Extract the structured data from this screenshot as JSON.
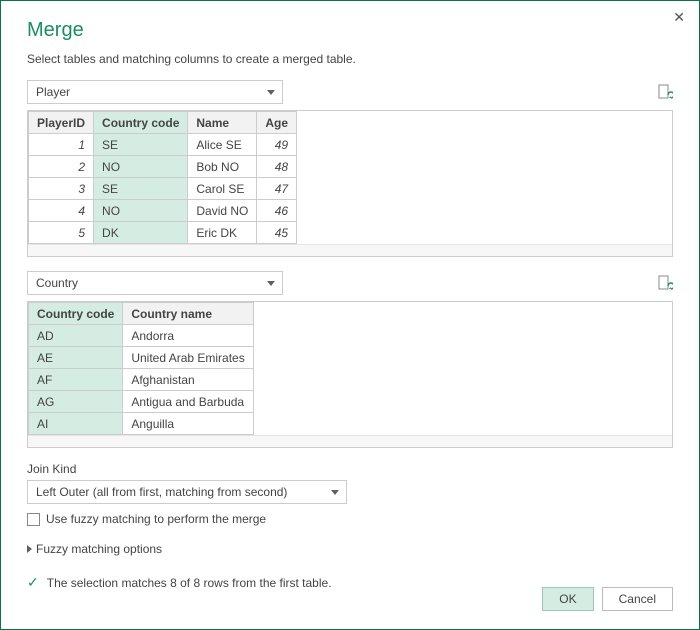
{
  "title": "Merge",
  "subtitle": "Select tables and matching columns to create a merged table.",
  "table1_select": "Player",
  "table1": {
    "headers": [
      "PlayerID",
      "Country code",
      "Name",
      "Age"
    ],
    "selectedCol": 1,
    "rows": [
      [
        "1",
        "SE",
        "Alice SE",
        "49"
      ],
      [
        "2",
        "NO",
        "Bob NO",
        "48"
      ],
      [
        "3",
        "SE",
        "Carol SE",
        "47"
      ],
      [
        "4",
        "NO",
        "David NO",
        "46"
      ],
      [
        "5",
        "DK",
        "Eric DK",
        "45"
      ]
    ],
    "numericCols": [
      0,
      3
    ]
  },
  "table2_select": "Country",
  "table2": {
    "headers": [
      "Country code",
      "Country name"
    ],
    "selectedCol": 0,
    "rows": [
      [
        "AD",
        "Andorra"
      ],
      [
        "AE",
        "United Arab Emirates"
      ],
      [
        "AF",
        "Afghanistan"
      ],
      [
        "AG",
        "Antigua and Barbuda"
      ],
      [
        "AI",
        "Anguilla"
      ]
    ],
    "numericCols": []
  },
  "joinKindLabel": "Join Kind",
  "joinKindValue": "Left Outer (all from first, matching from second)",
  "fuzzyCheckboxLabel": "Use fuzzy matching to perform the merge",
  "fuzzyOptionsLabel": "Fuzzy matching options",
  "statusText": "The selection matches 8 of 8 rows from the first table.",
  "buttons": {
    "ok": "OK",
    "cancel": "Cancel"
  }
}
